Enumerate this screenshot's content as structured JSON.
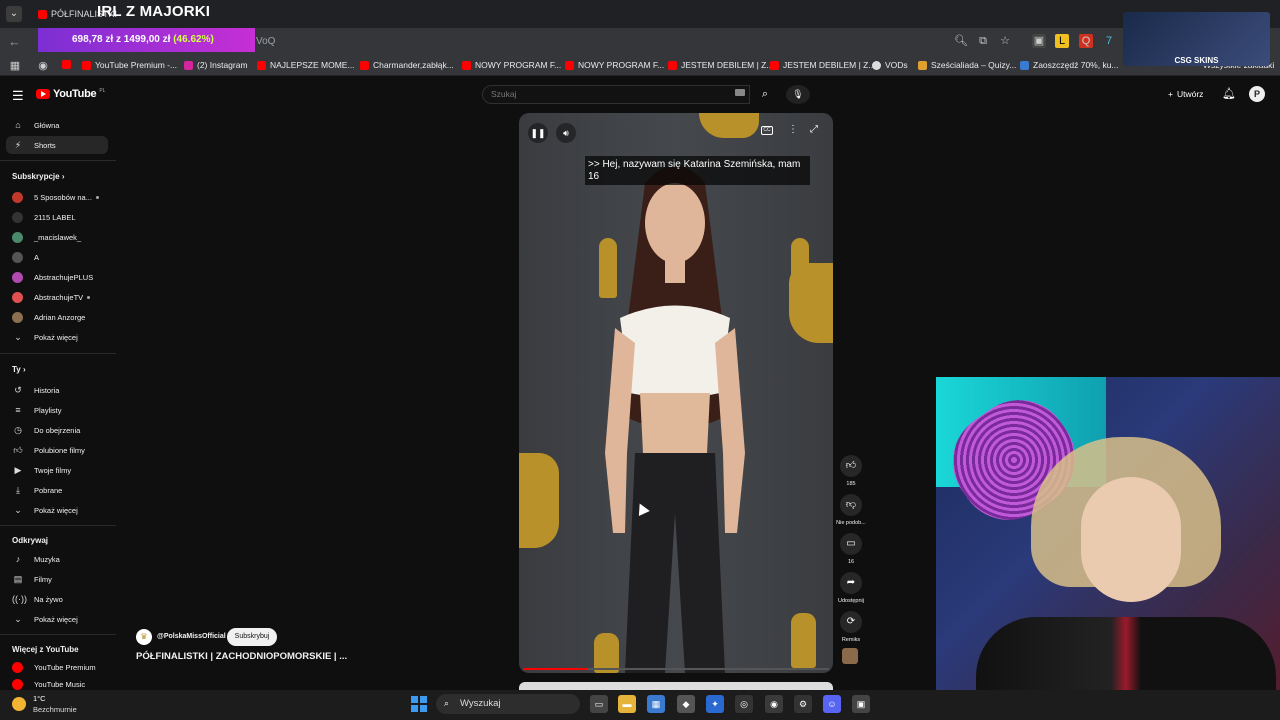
{
  "browser": {
    "tab_title": "PÓŁFINALISTKI",
    "overlay_title": "IRL Z MAJORKI",
    "donation": {
      "amount": "698,78 zł",
      "sep": "z",
      "goal": "1499,00 zł",
      "percent": "(46.62%)"
    },
    "url_fragment": "VoQ",
    "bookmarks": [
      "YouTube Premium -...",
      "(2) Instagram",
      "NAJLEPSZE MOME...",
      "Charmander,zabłąk...",
      "NOWY PROGRAM F...",
      "NOWY PROGRAM F...",
      "JESTEM DEBILEM | Z...",
      "JESTEM DEBILEM | Z...",
      "VODs",
      "Sześcialiada – Quizy...",
      "Zaoszczędź 70%, ku...",
      "Wszystkie zakładki"
    ],
    "sponsor": "CSG SKINS"
  },
  "youtube": {
    "logo": "YouTube",
    "region": "PL",
    "search_placeholder": "Szukaj",
    "create": "Utwórz",
    "avatar": "P"
  },
  "sidebar": {
    "main": [
      {
        "label": "Główna",
        "icon": "home-icon"
      },
      {
        "label": "Shorts",
        "icon": "shorts-icon",
        "active": true
      }
    ],
    "subs_header": "Subskrypcje",
    "subs": [
      {
        "label": "5 Sposobów na...",
        "color": "#c0392b",
        "dot": true
      },
      {
        "label": "2115 LABEL",
        "color": "#333333",
        "dot": false
      },
      {
        "label": "_macislawek_",
        "color": "#4a8a6a",
        "dot": false
      },
      {
        "label": "A",
        "color": "#555555",
        "dot": false
      },
      {
        "label": "AbstrachujePLUS",
        "color": "#b04ab0",
        "dot": false
      },
      {
        "label": "AbstrachujeTV",
        "color": "#e05050",
        "dot": true
      },
      {
        "label": "Adrian Anzorge",
        "color": "#8a7050",
        "dot": false
      }
    ],
    "subs_more": "Pokaż więcej",
    "you_header": "Ty",
    "you": [
      {
        "label": "Historia",
        "icon": "history-icon"
      },
      {
        "label": "Playlisty",
        "icon": "playlist-icon"
      },
      {
        "label": "Do obejrzenia",
        "icon": "watch-later-icon"
      },
      {
        "label": "Polubione filmy",
        "icon": "liked-icon"
      },
      {
        "label": "Twoje filmy",
        "icon": "your-videos-icon"
      },
      {
        "label": "Pobrane",
        "icon": "download-icon"
      },
      {
        "label": "Pokaż więcej",
        "icon": "chevron-down-icon"
      }
    ],
    "explore_header": "Odkrywaj",
    "explore": [
      {
        "label": "Muzyka",
        "icon": "music-icon"
      },
      {
        "label": "Filmy",
        "icon": "film-icon"
      },
      {
        "label": "Na żywo",
        "icon": "live-icon"
      },
      {
        "label": "Pokaż więcej",
        "icon": "chevron-down-icon"
      }
    ],
    "more_header": "Więcej z YouTube",
    "more": [
      {
        "label": "YouTube Premium"
      },
      {
        "label": "YouTube Music"
      }
    ]
  },
  "short": {
    "caption": ">> Hej, nazywam się Katarina Szemińska, mam 16",
    "progress": 0.21,
    "actions": [
      {
        "name": "like",
        "label": "185",
        "icon": "thumbs-up-icon"
      },
      {
        "name": "dislike",
        "label": "Nie podob...",
        "icon": "thumbs-down-icon"
      },
      {
        "name": "comments",
        "label": "16",
        "icon": "comment-icon"
      },
      {
        "name": "share",
        "label": "Udostępnij",
        "icon": "share-icon"
      },
      {
        "name": "remix",
        "label": "Remiks",
        "icon": "remix-icon"
      }
    ],
    "channel": "@PolskaMissOfficial",
    "subscribe": "Subskrybuj",
    "title": "PÓŁFINALISTKI | ZACHODNIOPOMORSKIE | ..."
  },
  "taskbar": {
    "temp": "1°C",
    "weather": "Bezchmurnie",
    "search": "Wyszukaj"
  }
}
